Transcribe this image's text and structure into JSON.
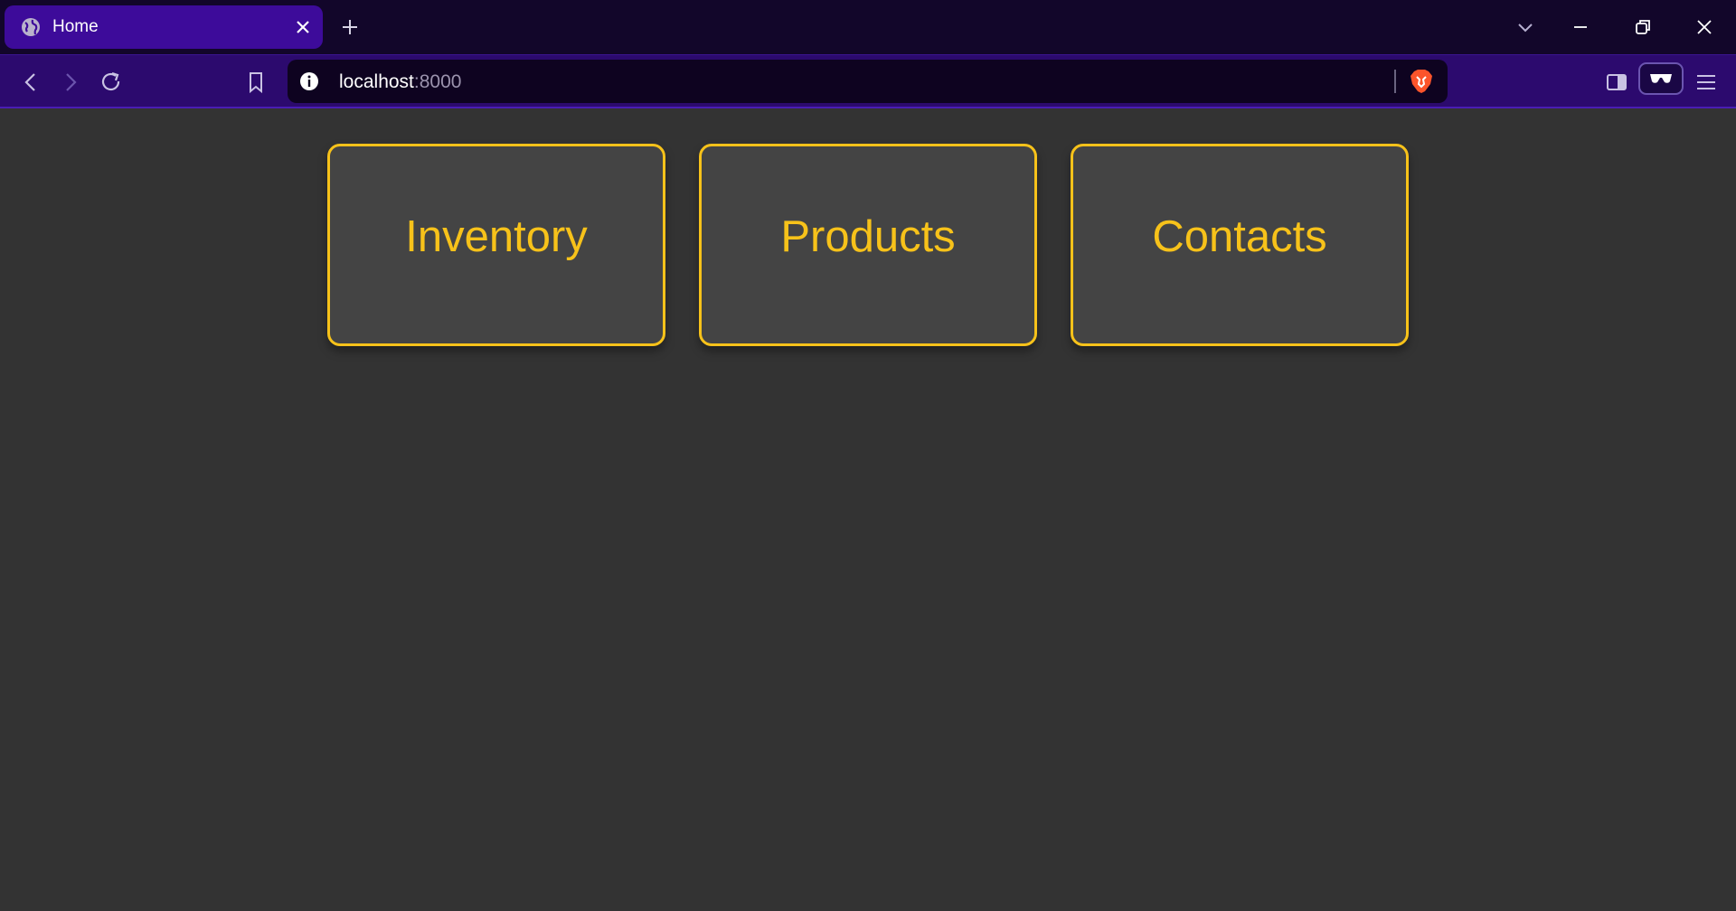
{
  "browser": {
    "tab": {
      "title": "Home",
      "favicon": "globe-icon",
      "close_icon": "close-icon"
    },
    "new_tab_icon": "plus-icon",
    "window_controls": [
      "chevron-down-icon",
      "minimize-icon",
      "restore-icon",
      "close-icon"
    ],
    "nav": [
      "back-icon",
      "forward-icon",
      "reload-icon",
      "bookmark-icon"
    ],
    "url": {
      "host": "localhost",
      "port": ":8000",
      "info_icon": "info-icon",
      "shields_icon": "brave-lion-icon"
    },
    "right_icons": [
      "sidebar-icon",
      "reader-mode-icon",
      "menu-icon"
    ],
    "colors": {
      "titlebar": "#12062a",
      "tab_active": "#3d0b9a",
      "toolbar": "#2c0a6e",
      "urlbar": "#0e0320"
    }
  },
  "page": {
    "background": "#333333",
    "accent": "#f7c21a",
    "card_background": "#444444",
    "cards": [
      {
        "label": "Inventory"
      },
      {
        "label": "Products"
      },
      {
        "label": "Contacts"
      }
    ]
  }
}
